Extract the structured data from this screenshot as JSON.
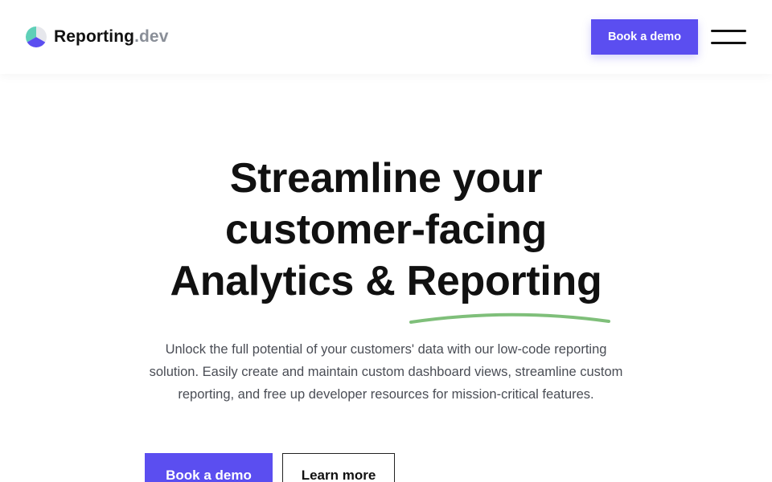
{
  "header": {
    "logo": {
      "name": "Reporting",
      "tld": ".dev",
      "icon": "pie-chart-logo-icon"
    },
    "cta_label": "Book a demo",
    "menu_icon": "hamburger-menu-icon"
  },
  "hero": {
    "title_lines": [
      "Streamline your",
      "customer-facing",
      "Analytics & Reporting"
    ],
    "subtitle": "Unlock the full potential of your customers' data with our low-code reporting solution. Easily create and maintain custom dashboard views, streamline custom reporting, and free up developer resources for mission-critical features.",
    "primary_cta": "Book a demo",
    "secondary_cta": "Learn more"
  },
  "colors": {
    "accent": "#5b4ef0",
    "underline": "#7fbf7a",
    "logo_teal": "#5fd0b8",
    "logo_purple": "#5b4ef0",
    "text": "#111111",
    "muted": "#4a4d55"
  }
}
